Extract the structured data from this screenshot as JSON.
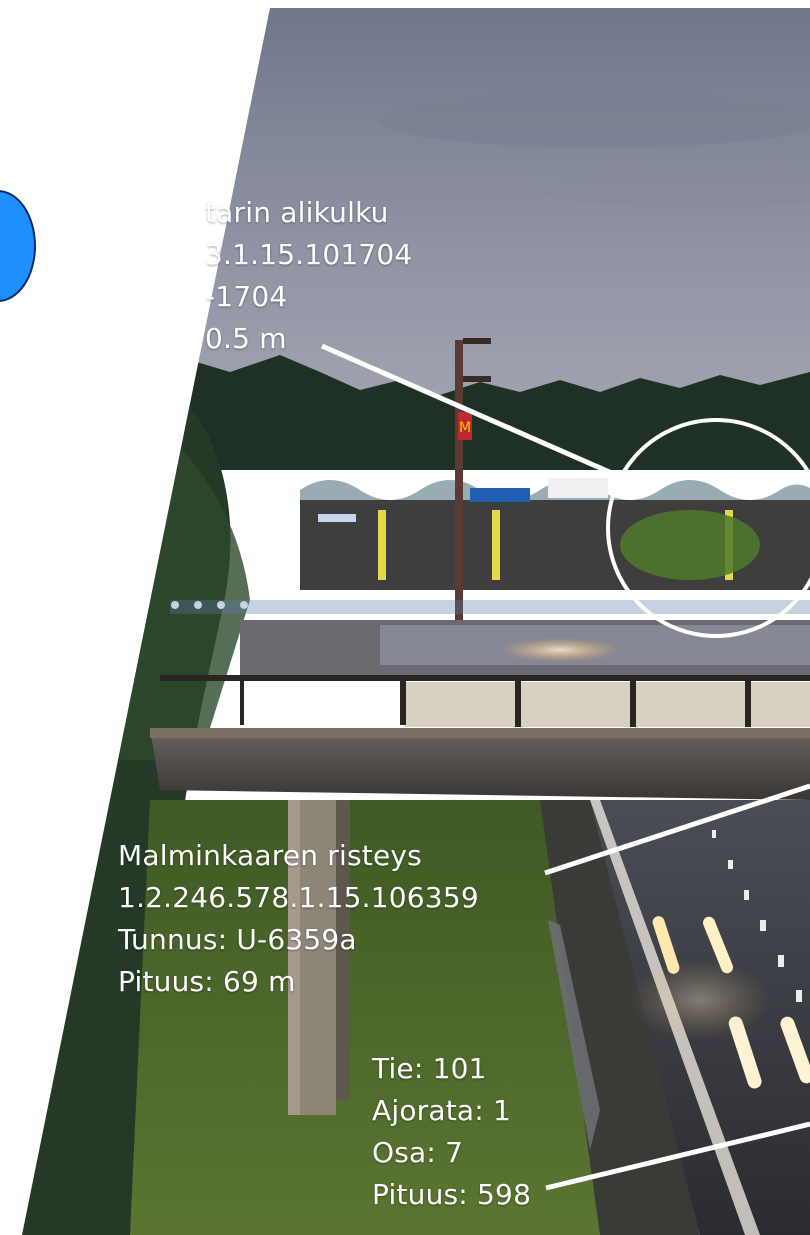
{
  "scene": {
    "description_colors": {
      "sky_top": "#6b7388",
      "sky_bottom": "#9c9fae",
      "tree_dark": "#1f3024",
      "grass": "#4f6a2c",
      "road": "#3b3f48",
      "accent_blue": "#1e8fff"
    }
  },
  "labels": {
    "top": {
      "line1": "tarin alikulku",
      "line2": "3.1.15.101704",
      "line3": "-1704",
      "line4": "0.5 m"
    },
    "middle": {
      "line1": "Malminkaaren risteys",
      "line2": "1.2.246.578.1.15.106359",
      "line3": "Tunnus: U-6359a",
      "line4": "Pituus: 69 m"
    },
    "road": {
      "line1": "Tie: 101",
      "line2": "Ajorata: 1",
      "line3": "Osa: 7",
      "line4": "Pituus: 598"
    }
  }
}
